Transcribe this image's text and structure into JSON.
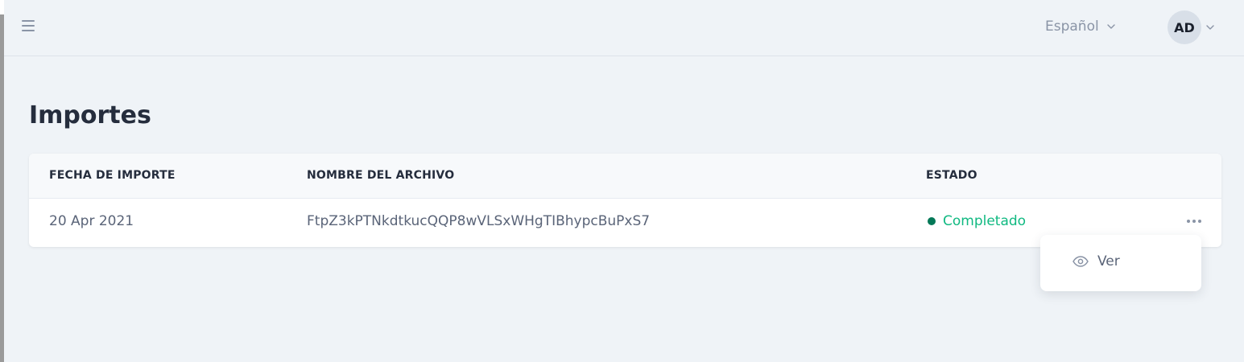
{
  "header": {
    "language": "Español",
    "user_initials": "AD"
  },
  "page": {
    "title": "Importes"
  },
  "table": {
    "columns": [
      "FECHA DE IMPORTE",
      "NOMBRE DEL ARCHIVO",
      "ESTADO"
    ],
    "rows": [
      {
        "date": "20 Apr 2021",
        "filename": "FtpZ3kPTNkdtkucQQP8wVLSxWHgTIBhypcBuPxS7",
        "status": "Completado"
      }
    ]
  },
  "row_menu": {
    "items": [
      {
        "label": "Ver",
        "icon": "eye-icon"
      }
    ]
  },
  "colors": {
    "status_dot": "#047857",
    "status_text": "#10b981"
  }
}
